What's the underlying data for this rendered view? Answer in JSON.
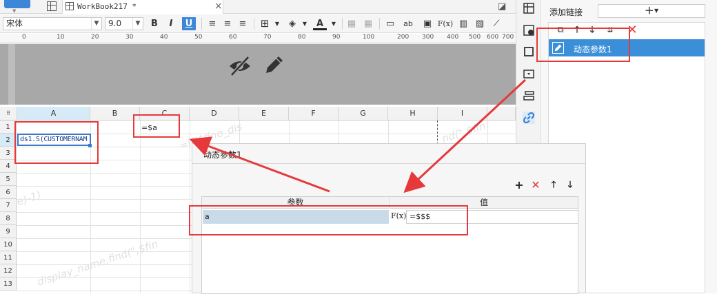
{
  "window": {
    "tab_title": "WorkBook217 *",
    "close_glyph": "×"
  },
  "toolbar": {
    "font_name": "宋体",
    "font_size": "9.0",
    "bold": "B",
    "italic": "I",
    "underline": "U",
    "text_ab": "ab",
    "formula": "F(x)"
  },
  "ruler": {
    "ticks": [
      "0",
      "10",
      "20",
      "30",
      "40",
      "50",
      "60",
      "70",
      "80",
      "90",
      "100",
      "200",
      "300",
      "400",
      "500",
      "600",
      "700"
    ]
  },
  "sheet": {
    "columns": [
      "A",
      "B",
      "C",
      "D",
      "E",
      "F",
      "G",
      "H",
      "I"
    ],
    "rows": [
      "1",
      "2",
      "3",
      "4",
      "5",
      "6",
      "7",
      "8",
      "9",
      "10",
      "11",
      "12",
      "13"
    ],
    "cell_a2": "ds1.S(CUSTOMERNAM",
    "cell_c1": "=$a",
    "watermarks": [
      "=if($fine_dis",
      "e)-1)",
      "display_name,find(\",$fin",
      "nd(\",$fin"
    ]
  },
  "right_panel": {
    "title": "添加链接",
    "add_symbol": "+",
    "item_label": "动态参数1"
  },
  "dialog": {
    "title": "动态参数1",
    "header_param": "参数",
    "header_value": "值",
    "row_param": "a",
    "row_fx": "F(x)",
    "row_value": "=$$$"
  },
  "colors": {
    "accent_blue": "#3b8fd9",
    "annotation_red": "#e5393b",
    "selection_border": "#3a78c9"
  }
}
